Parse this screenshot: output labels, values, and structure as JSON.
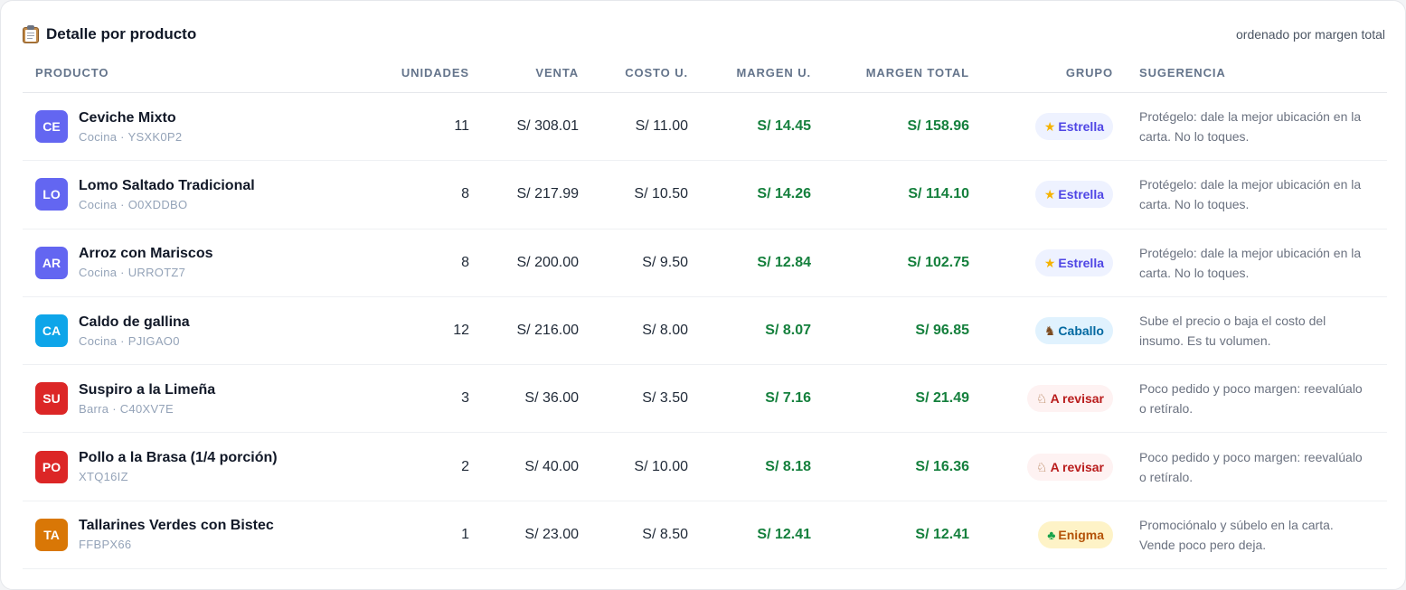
{
  "header": {
    "title": "Detalle por producto",
    "icon": "clipboard-icon",
    "subtitle": "ordenado por margen total"
  },
  "columns": {
    "producto": "PRODUCTO",
    "unidades": "UNIDADES",
    "venta": "VENTA",
    "costo": "COSTO U.",
    "margen_u": "MARGEN U.",
    "margen_total": "MARGEN TOTAL",
    "grupo": "GRUPO",
    "sugerencia": "SUGERENCIA"
  },
  "rows": [
    {
      "initials": "CE",
      "avatar_color": "#6366f1",
      "name": "Ceviche Mixto",
      "sub": "Cocina · YSXK0P2",
      "unidades": "11",
      "venta": "S/ 308.01",
      "costo": "S/ 11.00",
      "margen_u": "S/ 14.45",
      "margen_total": "S/ 158.96",
      "grupo": "Estrella",
      "grupo_icon": "★",
      "grupo_icon_name": "star-icon",
      "grupo_bg": "#eef2ff",
      "grupo_fg": "#4f46e5",
      "grupo_icon_color": "#f5b301",
      "sugerencia": "Protégelo: dale la mejor ubicación en la carta. No lo toques."
    },
    {
      "initials": "LO",
      "avatar_color": "#6366f1",
      "name": "Lomo Saltado Tradicional",
      "sub": "Cocina · O0XDDBO",
      "unidades": "8",
      "venta": "S/ 217.99",
      "costo": "S/ 10.50",
      "margen_u": "S/ 14.26",
      "margen_total": "S/ 114.10",
      "grupo": "Estrella",
      "grupo_icon": "★",
      "grupo_icon_name": "star-icon",
      "grupo_bg": "#eef2ff",
      "grupo_fg": "#4f46e5",
      "grupo_icon_color": "#f5b301",
      "sugerencia": "Protégelo: dale la mejor ubicación en la carta. No lo toques."
    },
    {
      "initials": "AR",
      "avatar_color": "#6366f1",
      "name": "Arroz con Mariscos",
      "sub": "Cocina · URROTZ7",
      "unidades": "8",
      "venta": "S/ 200.00",
      "costo": "S/ 9.50",
      "margen_u": "S/ 12.84",
      "margen_total": "S/ 102.75",
      "grupo": "Estrella",
      "grupo_icon": "★",
      "grupo_icon_name": "star-icon",
      "grupo_bg": "#eef2ff",
      "grupo_fg": "#4f46e5",
      "grupo_icon_color": "#f5b301",
      "sugerencia": "Protégelo: dale la mejor ubicación en la carta. No lo toques."
    },
    {
      "initials": "CA",
      "avatar_color": "#0ea5e9",
      "name": "Caldo de gallina",
      "sub": "Cocina · PJIGAO0",
      "unidades": "12",
      "venta": "S/ 216.00",
      "costo": "S/ 8.00",
      "margen_u": "S/ 8.07",
      "margen_total": "S/ 96.85",
      "grupo": "Caballo",
      "grupo_icon": "♞",
      "grupo_icon_name": "horse-icon",
      "grupo_bg": "#e0f2fe",
      "grupo_fg": "#0369a1",
      "grupo_icon_color": "#7c4a1e",
      "sugerencia": "Sube el precio o baja el costo del insumo. Es tu volumen."
    },
    {
      "initials": "SU",
      "avatar_color": "#dc2626",
      "name": "Suspiro a la Limeña",
      "sub": "Barra · C40XV7E",
      "unidades": "3",
      "venta": "S/ 36.00",
      "costo": "S/ 3.50",
      "margen_u": "S/ 7.16",
      "margen_total": "S/ 21.49",
      "grupo": "A revisar",
      "grupo_icon": "♘",
      "grupo_icon_name": "dog-icon",
      "grupo_bg": "#fef2f2",
      "grupo_fg": "#b91c1c",
      "grupo_icon_color": "#a0622d",
      "sugerencia": "Poco pedido y poco margen: reevalúalo o retíralo."
    },
    {
      "initials": "PO",
      "avatar_color": "#dc2626",
      "name": "Pollo a la Brasa (1/4 porción)",
      "sub": "XTQ16IZ",
      "unidades": "2",
      "venta": "S/ 40.00",
      "costo": "S/ 10.00",
      "margen_u": "S/ 8.18",
      "margen_total": "S/ 16.36",
      "grupo": "A revisar",
      "grupo_icon": "♘",
      "grupo_icon_name": "dog-icon",
      "grupo_bg": "#fef2f2",
      "grupo_fg": "#b91c1c",
      "grupo_icon_color": "#a0622d",
      "sugerencia": "Poco pedido y poco margen: reevalúalo o retíralo."
    },
    {
      "initials": "TA",
      "avatar_color": "#d97706",
      "name": "Tallarines Verdes con Bistec",
      "sub": "FFBPX66",
      "unidades": "1",
      "venta": "S/ 23.00",
      "costo": "S/ 8.50",
      "margen_u": "S/ 12.41",
      "margen_total": "S/ 12.41",
      "grupo": "Enigma",
      "grupo_icon": "♣",
      "grupo_icon_name": "puzzle-icon",
      "grupo_bg": "#fef3c7",
      "grupo_fg": "#b45309",
      "grupo_icon_color": "#16a34a",
      "sugerencia": "Promociónalo y súbelo en la carta. Vende poco pero deja."
    }
  ]
}
